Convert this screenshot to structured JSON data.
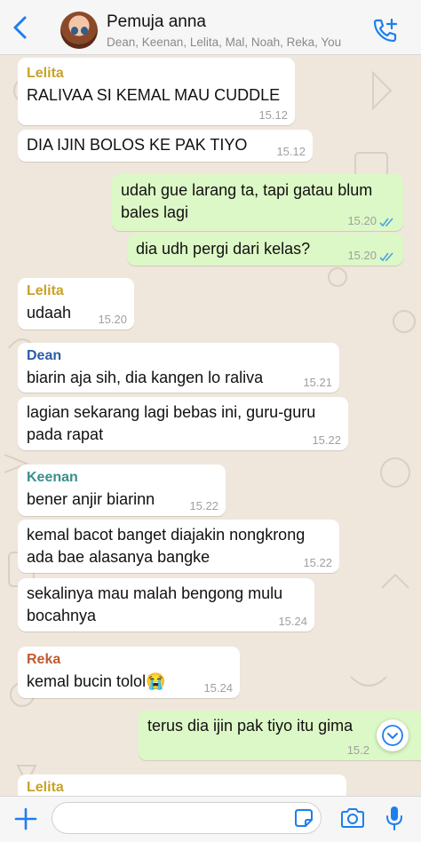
{
  "header": {
    "title": "Pemuja anna",
    "participants": "Dean, Keenan, Lelita, Mal, Noah, Reka, You"
  },
  "messages": [
    {
      "sender": "Lelita",
      "sender_color": "#c9a227",
      "lines": [
        "RALIVAA SI KEMAL MAU CUDDLE"
      ],
      "time": "15.12"
    },
    {
      "lines": [
        "DIA IJIN BOLOS KE PAK TIYO"
      ],
      "time": "15.12"
    },
    {
      "lines": [
        "udah gue larang ta, tapi gatau blum",
        "bales lagi"
      ],
      "time": "15.20",
      "status": "read"
    },
    {
      "lines": [
        "dia udh pergi dari kelas?"
      ],
      "time": "15.20",
      "status": "read"
    },
    {
      "sender": "Lelita",
      "sender_color": "#c9a227",
      "lines": [
        "udaah"
      ],
      "time": "15.20"
    },
    {
      "sender": "Dean",
      "sender_color": "#2a5da8",
      "lines": [
        "biarin aja sih, dia kangen lo raliva"
      ],
      "time": "15.21"
    },
    {
      "lines": [
        "lagian sekarang lagi bebas ini, guru-guru",
        "pada rapat"
      ],
      "time": "15.22"
    },
    {
      "sender": "Keenan",
      "sender_color": "#3a8f8a",
      "lines": [
        "bener anjir biarinn"
      ],
      "time": "15.22"
    },
    {
      "lines": [
        "kemal bacot banget diajakin nongkrong",
        "ada bae alasanya bangke"
      ],
      "time": "15.22"
    },
    {
      "lines": [
        "sekalinya mau malah bengong mulu",
        "bocahnya"
      ],
      "time": "15.24"
    },
    {
      "sender": "Reka",
      "sender_color": "#c25a2e",
      "lines": [
        "kemal bucin tolol😭"
      ],
      "time": "15.24"
    },
    {
      "lines": [
        "terus dia ijin pak tiyo itu gima"
      ],
      "time": "15.2"
    },
    {
      "sender": "Lelita",
      "sender_color": "#c9a227",
      "lines": [
        ""
      ],
      "time": ""
    }
  ],
  "composer": {
    "value": "",
    "placeholder": ""
  },
  "icons": {
    "back": "chevron-left-icon",
    "add_call": "phone-plus-icon",
    "scroll_down": "chevron-down-icon",
    "attach": "plus-icon",
    "sticker": "sticker-icon",
    "camera": "camera-icon",
    "mic": "microphone-icon"
  },
  "colors": {
    "accent": "#1b7ff0",
    "outgoing_bubble": "#dcf8c6",
    "incoming_bubble": "#ffffff",
    "read_ticks": "#4fa3e0"
  }
}
